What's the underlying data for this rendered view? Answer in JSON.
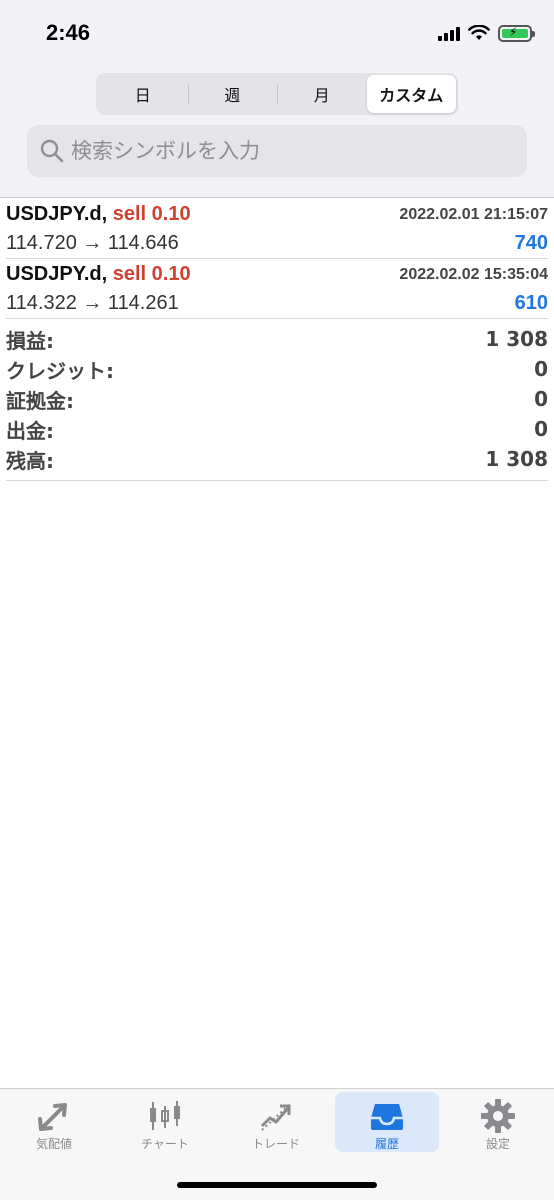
{
  "status_bar": {
    "time": "2:46"
  },
  "segments": [
    {
      "label": "日",
      "active": false
    },
    {
      "label": "週",
      "active": false
    },
    {
      "label": "月",
      "active": false
    },
    {
      "label": "カスタム",
      "active": true
    }
  ],
  "search": {
    "placeholder": "検索シンボルを入力",
    "value": ""
  },
  "deals": [
    {
      "symbol": "USDJPY.d,",
      "side": "sell 0.10",
      "time": "2022.02.01 21:15:07",
      "prices": "114.720 → 114.646",
      "profit": "740"
    },
    {
      "symbol": "USDJPY.d,",
      "side": "sell 0.10",
      "time": "2022.02.02 15:35:04",
      "prices": "114.322 → 114.261",
      "profit": "610"
    }
  ],
  "summary": [
    {
      "label": "損益:",
      "value": "1 308"
    },
    {
      "label": "クレジット:",
      "value": "0"
    },
    {
      "label": "証拠金:",
      "value": "0"
    },
    {
      "label": "出金:",
      "value": "0"
    },
    {
      "label": "残高:",
      "value": "1 308"
    }
  ],
  "tabs": [
    {
      "label": "気配値",
      "icon": "quotes-icon",
      "active": false
    },
    {
      "label": "チャート",
      "icon": "candlestick-icon",
      "active": false
    },
    {
      "label": "トレード",
      "icon": "trade-icon",
      "active": false
    },
    {
      "label": "履歴",
      "icon": "history-icon",
      "active": true
    },
    {
      "label": "設定",
      "icon": "gear-icon",
      "active": false
    }
  ],
  "colors": {
    "sell": "#d0412f",
    "profit": "#1f76e0",
    "active_tab": "#1f76e0"
  }
}
